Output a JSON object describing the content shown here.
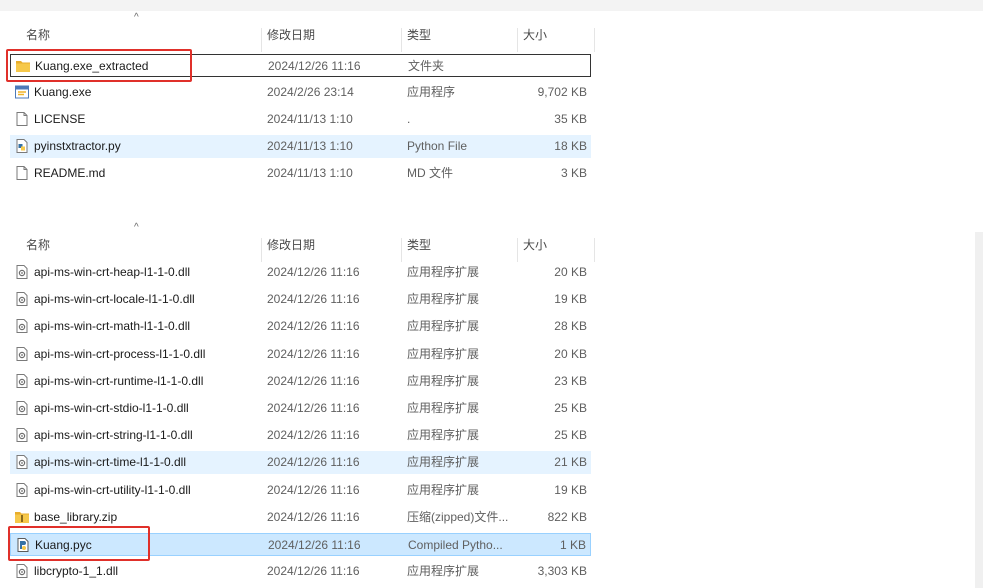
{
  "columns": {
    "name": "名称",
    "date": "修改日期",
    "type": "类型",
    "size": "大小",
    "sort_glyph": "^"
  },
  "colors": {
    "highlight": "#e0302a",
    "hover": "#e5f3ff",
    "selected": "#cce8ff",
    "folder": "#f4c145"
  },
  "panel1": {
    "rows": [
      {
        "name": "Kuang.exe_extracted",
        "date": "2024/12/26 11:16",
        "type": "文件夹",
        "size": "",
        "icon": "folder-icon"
      },
      {
        "name": "Kuang.exe",
        "date": "2024/2/26 23:14",
        "type": "应用程序",
        "size": "9,702 KB",
        "icon": "exe-icon"
      },
      {
        "name": "LICENSE",
        "date": "2024/11/13 1:10",
        "type": ".",
        "size": "35 KB",
        "icon": "file-icon"
      },
      {
        "name": "pyinstxtractor.py",
        "date": "2024/11/13 1:10",
        "type": "Python File",
        "size": "18 KB",
        "icon": "python-file-icon"
      },
      {
        "name": "README.md",
        "date": "2024/11/13 1:10",
        "type": "MD 文件",
        "size": "3 KB",
        "icon": "file-icon"
      }
    ]
  },
  "panel2": {
    "rows": [
      {
        "name": "api-ms-win-crt-heap-l1-1-0.dll",
        "date": "2024/12/26 11:16",
        "type": "应用程序扩展",
        "size": "20 KB",
        "icon": "dll-icon"
      },
      {
        "name": "api-ms-win-crt-locale-l1-1-0.dll",
        "date": "2024/12/26 11:16",
        "type": "应用程序扩展",
        "size": "19 KB",
        "icon": "dll-icon"
      },
      {
        "name": "api-ms-win-crt-math-l1-1-0.dll",
        "date": "2024/12/26 11:16",
        "type": "应用程序扩展",
        "size": "28 KB",
        "icon": "dll-icon"
      },
      {
        "name": "api-ms-win-crt-process-l1-1-0.dll",
        "date": "2024/12/26 11:16",
        "type": "应用程序扩展",
        "size": "20 KB",
        "icon": "dll-icon"
      },
      {
        "name": "api-ms-win-crt-runtime-l1-1-0.dll",
        "date": "2024/12/26 11:16",
        "type": "应用程序扩展",
        "size": "23 KB",
        "icon": "dll-icon"
      },
      {
        "name": "api-ms-win-crt-stdio-l1-1-0.dll",
        "date": "2024/12/26 11:16",
        "type": "应用程序扩展",
        "size": "25 KB",
        "icon": "dll-icon"
      },
      {
        "name": "api-ms-win-crt-string-l1-1-0.dll",
        "date": "2024/12/26 11:16",
        "type": "应用程序扩展",
        "size": "25 KB",
        "icon": "dll-icon"
      },
      {
        "name": "api-ms-win-crt-time-l1-1-0.dll",
        "date": "2024/12/26 11:16",
        "type": "应用程序扩展",
        "size": "21 KB",
        "icon": "dll-icon"
      },
      {
        "name": "api-ms-win-crt-utility-l1-1-0.dll",
        "date": "2024/12/26 11:16",
        "type": "应用程序扩展",
        "size": "19 KB",
        "icon": "dll-icon"
      },
      {
        "name": "base_library.zip",
        "date": "2024/12/26 11:16",
        "type": "压缩(zipped)文件...",
        "size": "822 KB",
        "icon": "zip-folder-icon"
      },
      {
        "name": "Kuang.pyc",
        "date": "2024/12/26 11:16",
        "type": "Compiled Pytho...",
        "size": "1 KB",
        "icon": "pyc-icon"
      },
      {
        "name": "libcrypto-1_1.dll",
        "date": "2024/12/26 11:16",
        "type": "应用程序扩展",
        "size": "3,303 KB",
        "icon": "dll-icon"
      }
    ]
  }
}
